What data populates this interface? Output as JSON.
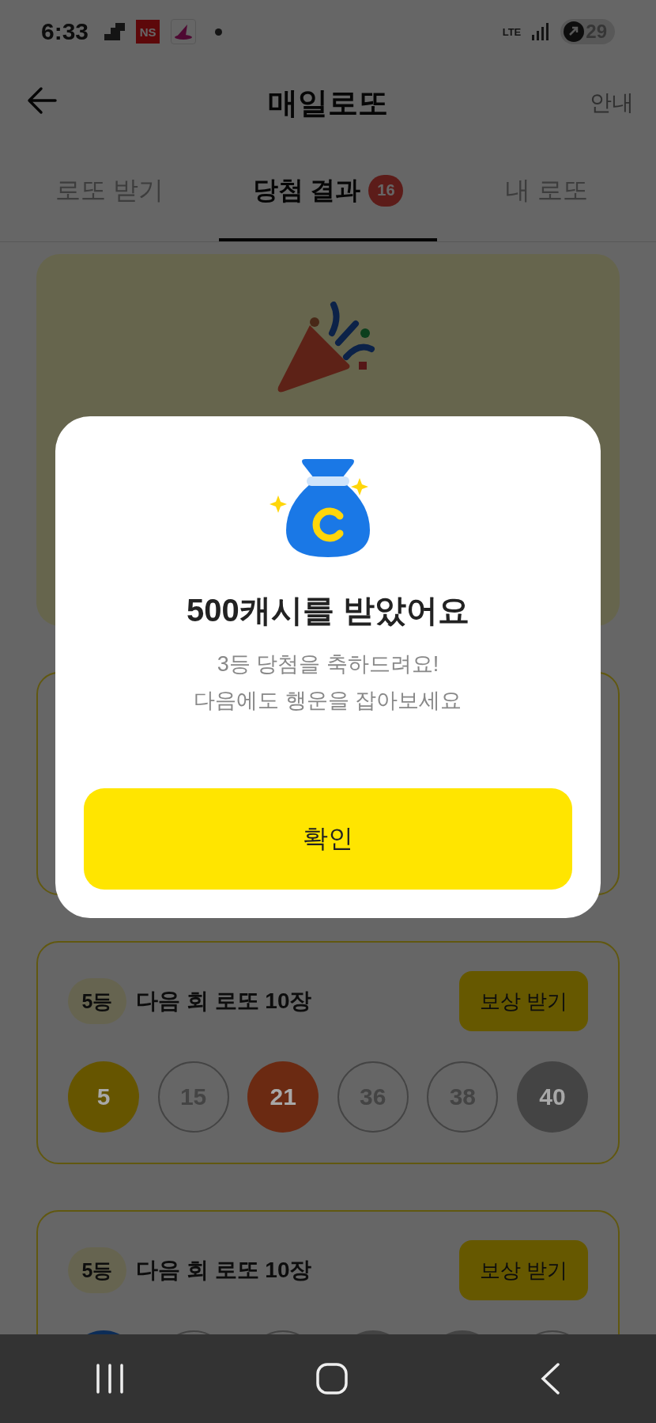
{
  "status_bar": {
    "time": "6:33",
    "notification_badge": "NS",
    "network": "LTE",
    "battery": "29"
  },
  "header": {
    "title": "매일로또",
    "action": "안내"
  },
  "tabs": [
    {
      "label": "로또 받기",
      "selected": false
    },
    {
      "label": "당첨 결과",
      "selected": true,
      "badge": "16"
    },
    {
      "label": "내 로또",
      "selected": false
    }
  ],
  "results": [
    {
      "rank": "5등",
      "title": "다음 회 로또 10장",
      "button": "보상 받기",
      "balls": [
        {
          "number": "5",
          "kind": "filled",
          "color": "#665500"
        },
        {
          "number": "15",
          "kind": "outline"
        },
        {
          "number": "21",
          "kind": "filled",
          "color": "#6b2a12"
        },
        {
          "number": "36",
          "kind": "outline"
        },
        {
          "number": "38",
          "kind": "outline"
        },
        {
          "number": "40",
          "kind": "filled",
          "color": "#444444"
        }
      ]
    },
    {
      "rank": "5등",
      "title": "다음 회 로또 10장",
      "button": "보상 받기",
      "balls": [
        {
          "kind": "filled",
          "color": "#0c2c57"
        },
        {
          "kind": "outline"
        },
        {
          "kind": "outline"
        },
        {
          "kind": "filled",
          "color": "#444444"
        },
        {
          "kind": "filled",
          "color": "#444444"
        },
        {
          "kind": "outline"
        }
      ]
    }
  ],
  "dialog": {
    "title": "500캐시를 받았어요",
    "message": [
      "3등 당첨을 축하드려요!",
      "다음에도 행운을 잡아보세요"
    ],
    "button": "확인"
  }
}
